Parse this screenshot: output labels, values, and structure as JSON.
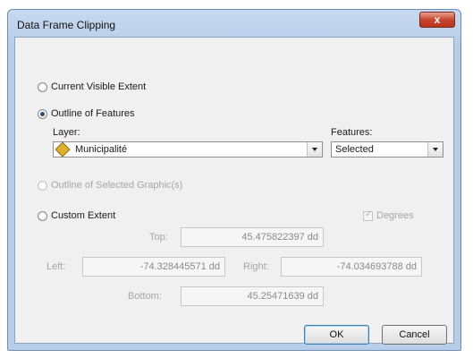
{
  "window": {
    "title": "Data Frame Clipping",
    "close_glyph": "x"
  },
  "options": {
    "current_visible_extent": "Current Visible Extent",
    "outline_of_features": "Outline of Features",
    "outline_of_selected_graphics": "Outline of Selected Graphic(s)",
    "custom_extent": "Custom Extent"
  },
  "layer": {
    "label": "Layer:",
    "value": "Municipalité",
    "icon": "layer-diamond-icon"
  },
  "features": {
    "label": "Features:",
    "value": "Selected"
  },
  "degrees": {
    "label": "Degrees",
    "checked": true
  },
  "extent": {
    "top_label": "Top:",
    "top_value": "45.475822397 dd",
    "left_label": "Left:",
    "left_value": "-74.328445571 dd",
    "right_label": "Right:",
    "right_value": "-74.034693788 dd",
    "bottom_label": "Bottom:",
    "bottom_value": "45.25471639 dd"
  },
  "buttons": {
    "ok": "OK",
    "cancel": "Cancel"
  }
}
